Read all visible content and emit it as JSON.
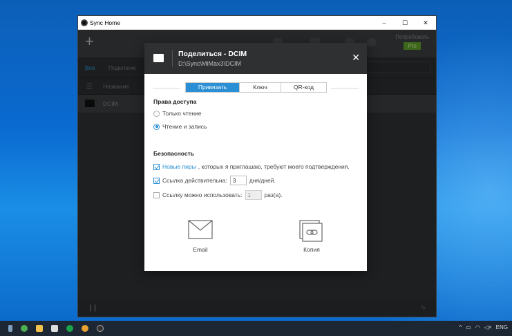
{
  "window": {
    "title": "Sync Home",
    "minimize": "–",
    "maximize": "☐",
    "close": "✕"
  },
  "toolbar": {
    "add": "+",
    "try_label": "Попробовать",
    "pro_label": "Pro"
  },
  "tabs": {
    "all": "Все",
    "connected": "Подключе"
  },
  "filelist": {
    "column_name": "Название",
    "rows": [
      {
        "name": "DCIM"
      }
    ]
  },
  "dialog": {
    "title": "Поделиться - DCIM",
    "path": "D:\\Sync\\MiMax3\\DCIM",
    "close": "✕",
    "segments": [
      "Привязать",
      "Ключ",
      "QR-код"
    ],
    "active_segment": 0,
    "access": {
      "title": "Права доступа",
      "read_only": "Только чтение",
      "read_write": "Чтение и запись",
      "selected": "read_write"
    },
    "security": {
      "title": "Безопасность",
      "new_peers_link": "Новые пиры",
      "new_peers_text": ", которых я приглашаю, требуют моего подтверждения.",
      "new_peers_checked": true,
      "link_valid_label": "Ссылка действительна:",
      "link_valid_value": "3",
      "link_valid_unit": "дня/дней.",
      "link_valid_checked": true,
      "link_uses_label": "Ссылку можно использовать:",
      "link_uses_value": "1",
      "link_uses_unit": "раз(а).",
      "link_uses_checked": false
    },
    "share": {
      "email_label": "Email",
      "copy_label": "Копия"
    }
  },
  "taskbar": {
    "tray_lang": "ENG"
  }
}
